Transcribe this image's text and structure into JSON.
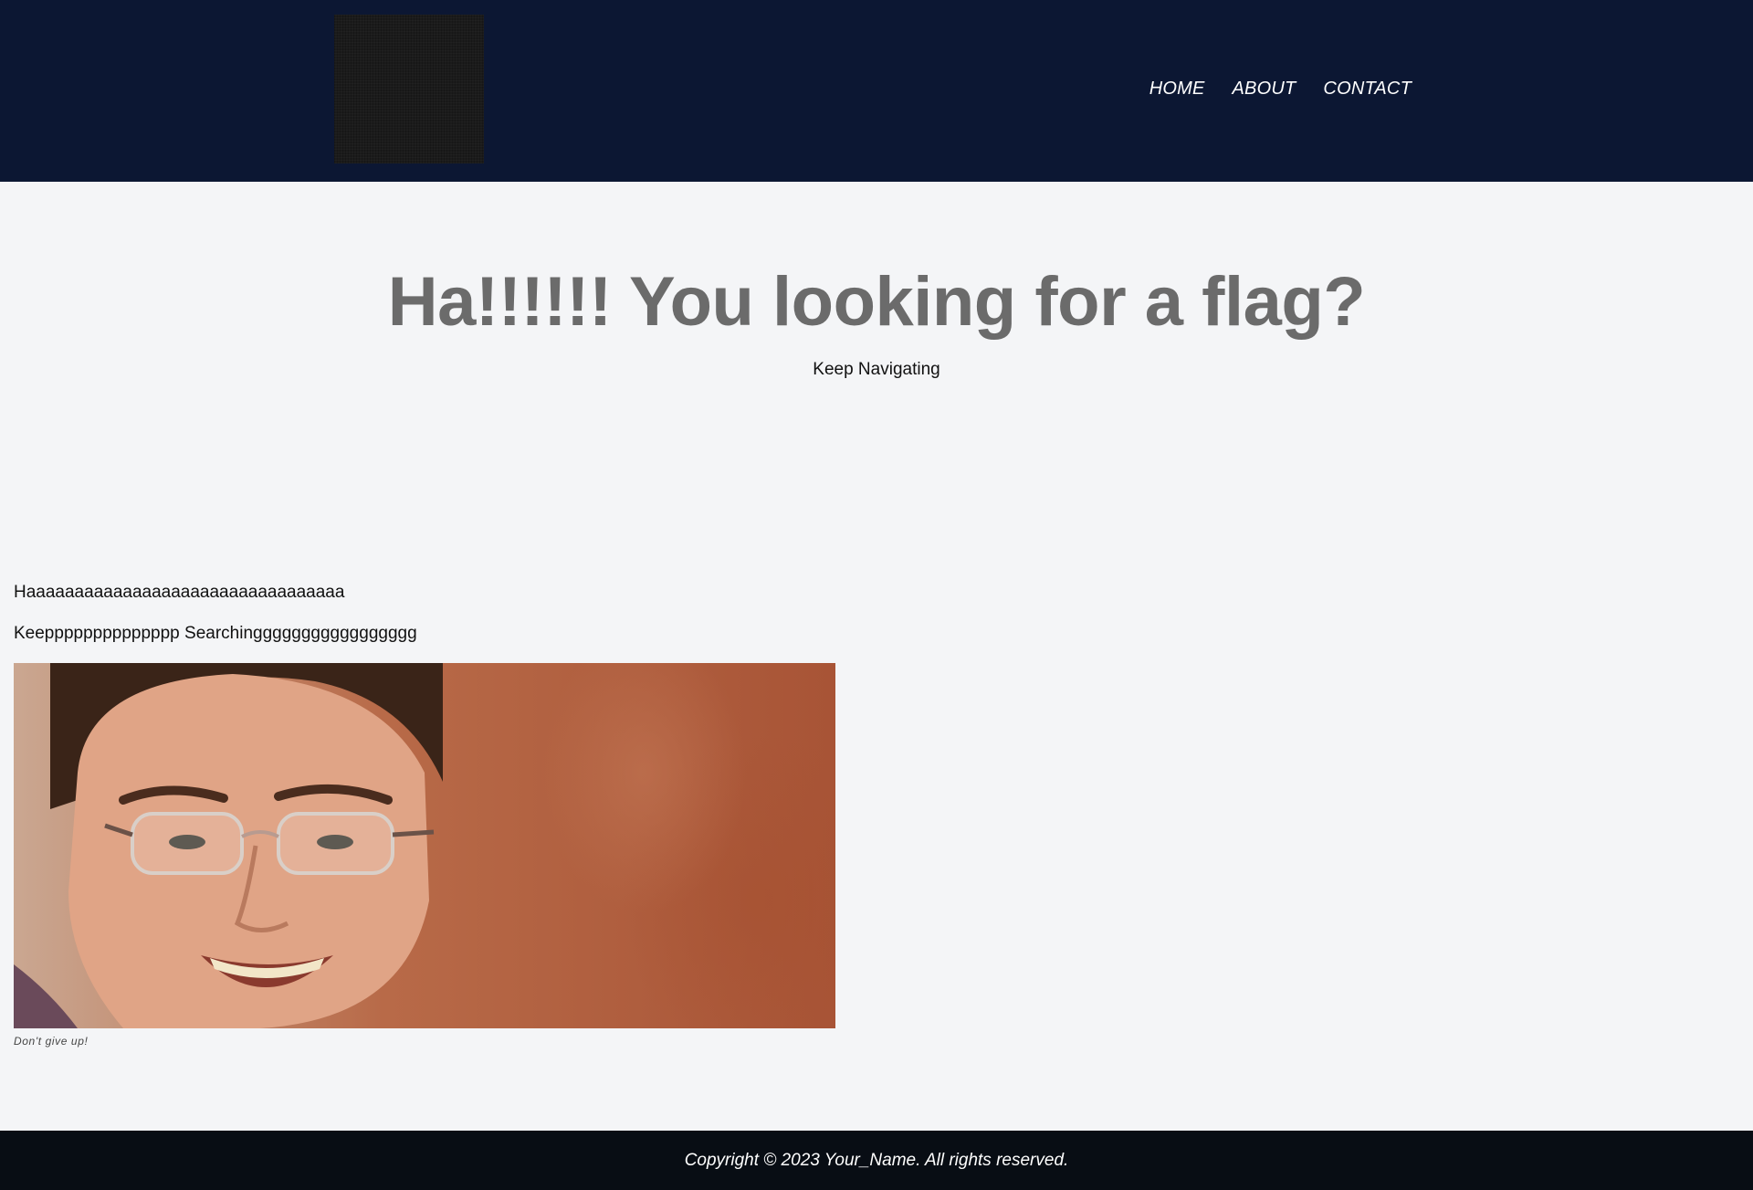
{
  "header": {
    "nav": [
      {
        "label": "HOME"
      },
      {
        "label": "ABOUT"
      },
      {
        "label": "CONTACT"
      }
    ]
  },
  "hero": {
    "title": "Ha!!!!!! You looking for a flag?",
    "subtitle": "Keep Navigating"
  },
  "content": {
    "paragraph1": "Haaaaaaaaaaaaaaaaaaaaaaaaaaaaaaaaa",
    "paragraph2": "Keepppppppppppppp Searchinggggggggggggggggg",
    "caption": "Don't give up!"
  },
  "footer": {
    "copyright": "Copyright © 2023 Your_Name. All rights reserved."
  },
  "colors": {
    "header_bg": "#0c1733",
    "page_bg": "#f4f5f7",
    "title_gray": "#6b6b6b",
    "footer_bg": "#080d14"
  }
}
